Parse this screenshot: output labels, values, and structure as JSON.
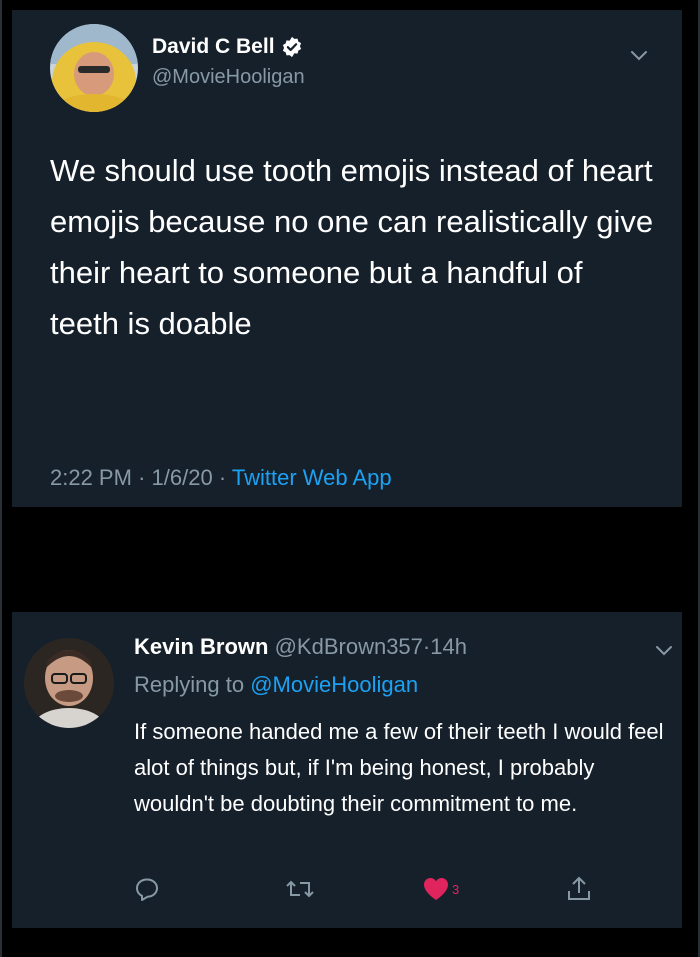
{
  "tweet": {
    "author": {
      "name": "David C Bell",
      "handle": "@MovieHooligan",
      "verified": true
    },
    "text": "We should use tooth emojis instead of heart emojis because no one can realistically give their heart to someone but a handful of teeth is doable",
    "time": "2:22 PM",
    "date": "1/6/20",
    "source": "Twitter Web App",
    "separator": "·"
  },
  "reply": {
    "author": {
      "name": "Kevin Brown",
      "handle": "@KdBrown357"
    },
    "age": "14h",
    "replying_prefix": "Replying to",
    "replying_to": "@MovieHooligan",
    "text": "If someone handed me a few of their teeth I would feel alot of things but, if I'm being honest, I probably wouldn't be doubting their commitment to me.",
    "likes": "3"
  },
  "colors": {
    "background": "#000000",
    "card": "#15202b",
    "text": "#ffffff",
    "muted": "#8899a6",
    "accent": "#1da1f2",
    "like": "#e0245e"
  },
  "icons": [
    "verified-badge-icon",
    "chevron-down-icon",
    "reply-icon",
    "retweet-icon",
    "heart-icon",
    "share-icon"
  ]
}
